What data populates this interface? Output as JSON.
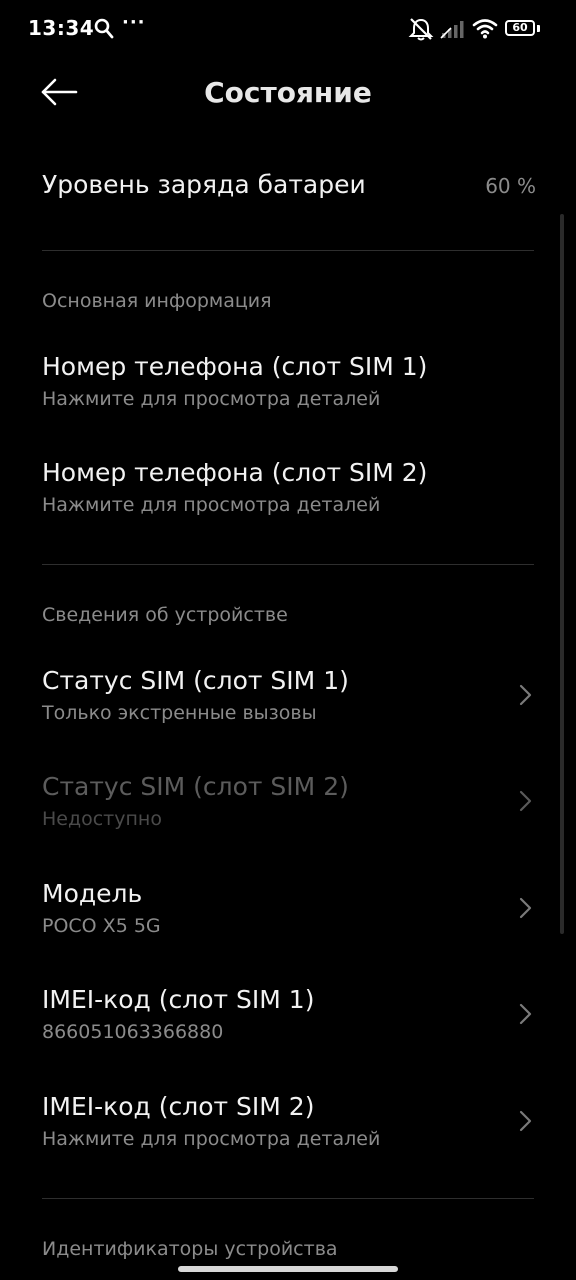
{
  "status_bar": {
    "time": "13:34",
    "dots": "···",
    "battery_level": "60",
    "icons": [
      "search-icon",
      "more-dots-icon",
      "mute-icon",
      "signal-icon",
      "wifi-icon",
      "battery-icon"
    ]
  },
  "header": {
    "title": "Состояние",
    "back_icon": "arrow-left-icon"
  },
  "battery": {
    "label": "Уровень заряда батареи",
    "value": "60 %"
  },
  "sections": {
    "basic_info": "Основная информация",
    "device_info": "Сведения об устройстве",
    "device_ids": "Идентификаторы устройства"
  },
  "basic_items": [
    {
      "title": "Номер телефона (слот SIM 1)",
      "subtitle": "Нажмите для просмотра деталей"
    },
    {
      "title": "Номер телефона (слот SIM 2)",
      "subtitle": "Нажмите для просмотра деталей"
    }
  ],
  "device_items": [
    {
      "title": "Статус SIM (слот SIM 1)",
      "subtitle": "Только экстренные вызовы",
      "enabled": true
    },
    {
      "title": "Статус SIM (слот SIM 2)",
      "subtitle": "Недоступно",
      "enabled": false
    },
    {
      "title": "Модель",
      "subtitle": "POCO X5 5G",
      "enabled": true
    },
    {
      "title": "IMEI-код (слот SIM 1)",
      "subtitle": "866051063366880",
      "enabled": true
    },
    {
      "title": "IMEI-код (слот SIM 2)",
      "subtitle": "Нажмите для просмотра деталей",
      "enabled": true
    }
  ],
  "colors": {
    "background": "#000000",
    "primary_text": "#f2f2f2",
    "secondary_text": "#8b8b8b",
    "disabled_text": "#5c5c5c",
    "divider": "#2e2e2e"
  }
}
